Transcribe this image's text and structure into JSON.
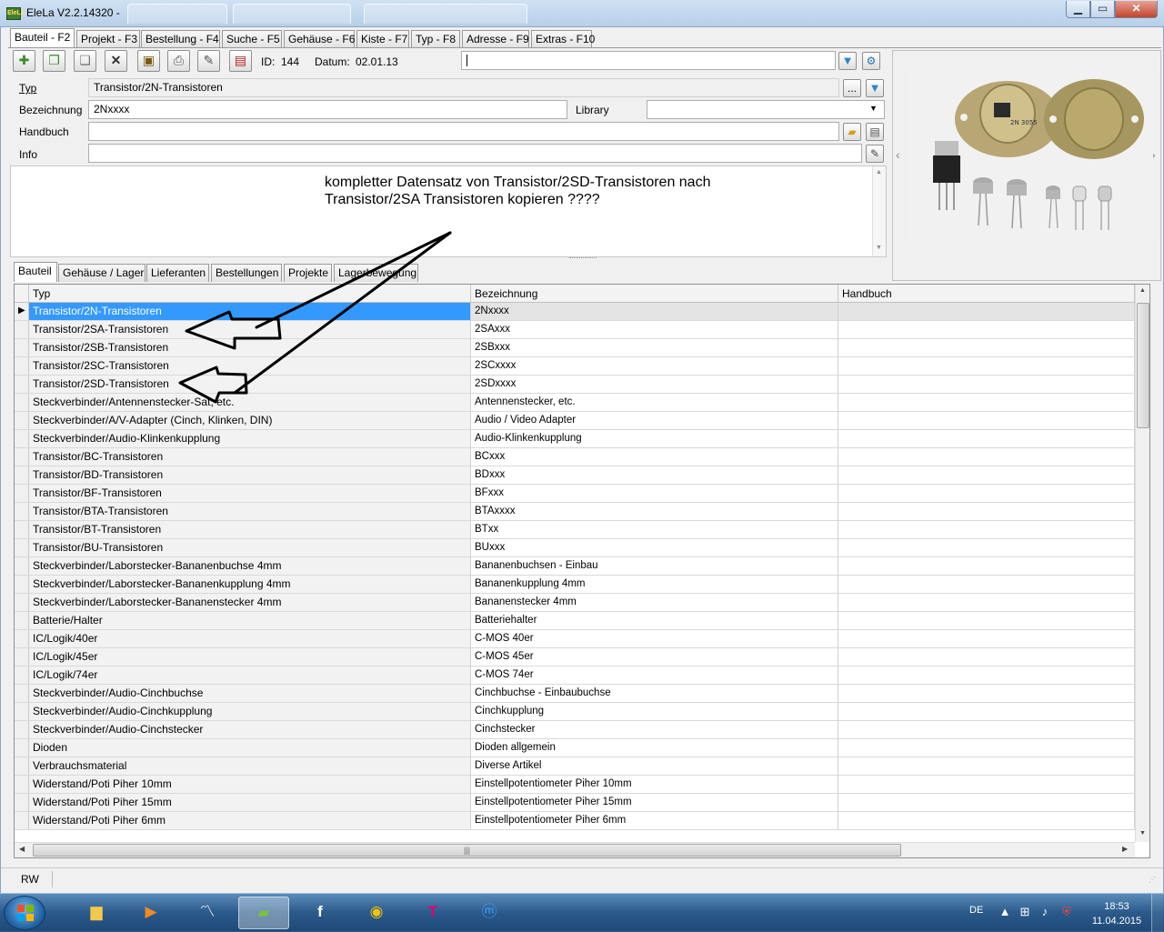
{
  "window": {
    "title": "EleLa V2.2.14320  -",
    "app_icon_text": "EleLa",
    "min_label": "▁",
    "max_label": "▭",
    "close_label": "✕"
  },
  "main_tabs": [
    {
      "label": "Bauteil - F2"
    },
    {
      "label": "Projekt - F3"
    },
    {
      "label": "Bestellung - F4"
    },
    {
      "label": "Suche - F5"
    },
    {
      "label": "Gehäuse - F6"
    },
    {
      "label": "Kiste - F7"
    },
    {
      "label": "Typ - F8"
    },
    {
      "label": "Adresse - F9"
    },
    {
      "label": "Extras - F10"
    }
  ],
  "record": {
    "id_label": "ID:",
    "id_value": "144",
    "date_label": "Datum:",
    "date_value": "02.01.13",
    "search_value": ""
  },
  "form": {
    "typ_label": "Typ",
    "typ_value": "Transistor/2N-Transistoren",
    "bezeichnung_label": "Bezeichnung",
    "bezeichnung_value": "2Nxxxx",
    "library_label": "Library",
    "library_value": "",
    "handbuch_label": "Handbuch",
    "handbuch_value": "",
    "info_label": "Info",
    "info_value": "",
    "ellipsis_label": "..."
  },
  "memo": {
    "line1": "kompletter Datensatz von Transistor/2SD-Transistoren nach",
    "line2": "Transistor/2SA Transistoren kopieren ????"
  },
  "photo_panel": {
    "left_arrow": "‹",
    "right_arrow": "›",
    "part_marking": "2N 3055"
  },
  "sub_tabs": [
    {
      "label": "Bauteil"
    },
    {
      "label": "Gehäuse / Lager"
    },
    {
      "label": "Lieferanten"
    },
    {
      "label": "Bestellungen"
    },
    {
      "label": "Projekte"
    },
    {
      "label": "Lagerbewegung"
    }
  ],
  "grid": {
    "columns": [
      "Typ",
      "Bezeichnung",
      "Handbuch"
    ],
    "selected_index": 0,
    "rows": [
      {
        "typ": "Transistor/2N-Transistoren",
        "bez": "2Nxxxx",
        "hb": ""
      },
      {
        "typ": "Transistor/2SA-Transistoren",
        "bez": "2SAxxx",
        "hb": ""
      },
      {
        "typ": "Transistor/2SB-Transistoren",
        "bez": "2SBxxx",
        "hb": ""
      },
      {
        "typ": "Transistor/2SC-Transistoren",
        "bez": "2SCxxxx",
        "hb": ""
      },
      {
        "typ": "Transistor/2SD-Transistoren",
        "bez": "2SDxxxx",
        "hb": ""
      },
      {
        "typ": "Steckverbinder/Antennenstecker-Sat, etc.",
        "bez": "Antennenstecker, etc.",
        "hb": ""
      },
      {
        "typ": "Steckverbinder/A/V-Adapter (Cinch, Klinken, DIN)",
        "bez": "Audio / Video Adapter",
        "hb": ""
      },
      {
        "typ": "Steckverbinder/Audio-Klinkenkupplung",
        "bez": "Audio-Klinkenkupplung",
        "hb": ""
      },
      {
        "typ": "Transistor/BC-Transistoren",
        "bez": "BCxxx",
        "hb": ""
      },
      {
        "typ": "Transistor/BD-Transistoren",
        "bez": "BDxxx",
        "hb": ""
      },
      {
        "typ": "Transistor/BF-Transistoren",
        "bez": "BFxxx",
        "hb": ""
      },
      {
        "typ": "Transistor/BTA-Transistoren",
        "bez": "BTAxxxx",
        "hb": ""
      },
      {
        "typ": "Transistor/BT-Transistoren",
        "bez": "BTxx",
        "hb": ""
      },
      {
        "typ": "Transistor/BU-Transistoren",
        "bez": "BUxxx",
        "hb": ""
      },
      {
        "typ": "Steckverbinder/Laborstecker-Bananenbuchse 4mm",
        "bez": "Bananenbuchsen - Einbau",
        "hb": ""
      },
      {
        "typ": "Steckverbinder/Laborstecker-Bananenkupplung 4mm",
        "bez": "Bananenkupplung 4mm",
        "hb": ""
      },
      {
        "typ": "Steckverbinder/Laborstecker-Bananenstecker 4mm",
        "bez": "Bananenstecker 4mm",
        "hb": ""
      },
      {
        "typ": "Batterie/Halter",
        "bez": "Batteriehalter",
        "hb": ""
      },
      {
        "typ": "IC/Logik/40er",
        "bez": "C-MOS 40er",
        "hb": ""
      },
      {
        "typ": "IC/Logik/45er",
        "bez": "C-MOS 45er",
        "hb": ""
      },
      {
        "typ": "IC/Logik/74er",
        "bez": "C-MOS 74er",
        "hb": ""
      },
      {
        "typ": "Steckverbinder/Audio-Cinchbuchse",
        "bez": "Cinchbuchse - Einbaubuchse",
        "hb": ""
      },
      {
        "typ": "Steckverbinder/Audio-Cinchkupplung",
        "bez": "Cinchkupplung",
        "hb": ""
      },
      {
        "typ": "Steckverbinder/Audio-Cinchstecker",
        "bez": "Cinchstecker",
        "hb": ""
      },
      {
        "typ": "Dioden",
        "bez": "Dioden allgemein",
        "hb": ""
      },
      {
        "typ": "Verbrauchsmaterial",
        "bez": "Diverse Artikel",
        "hb": ""
      },
      {
        "typ": "Widerstand/Poti Piher 10mm",
        "bez": "Einstellpotentiometer Piher 10mm",
        "hb": ""
      },
      {
        "typ": "Widerstand/Poti Piher 15mm",
        "bez": "Einstellpotentiometer Piher 15mm",
        "hb": ""
      },
      {
        "typ": "Widerstand/Poti Piher 6mm",
        "bez": "Einstellpotentiometer Piher 6mm",
        "hb": ""
      }
    ]
  },
  "status_bar": {
    "mode": "RW"
  },
  "taskbar": {
    "language": "DE",
    "time": "18:53",
    "date": "11.04.2015"
  },
  "colors": {
    "selection": "#3399ff",
    "annotation_arrow": "#000000",
    "taskbar": "#2b5a8b"
  }
}
